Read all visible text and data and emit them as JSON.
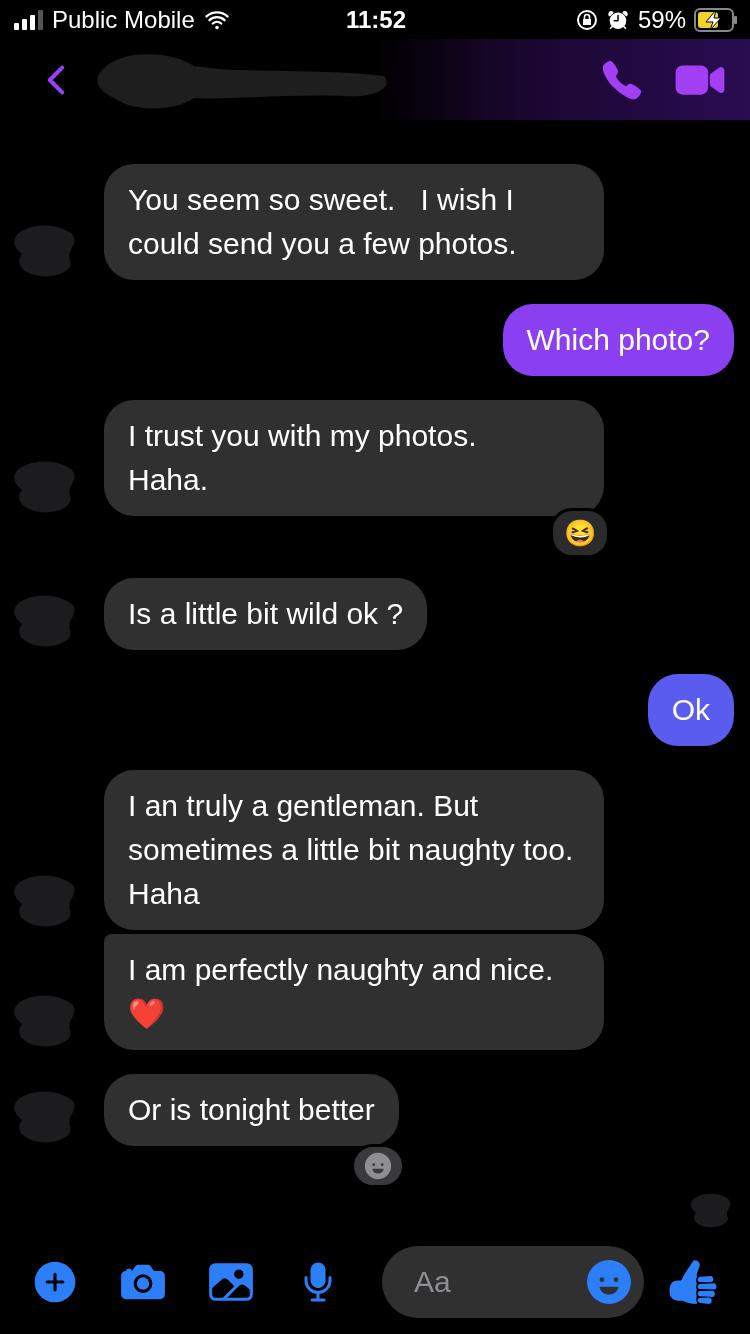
{
  "status_bar": {
    "carrier": "Public Mobile",
    "time": "11:52",
    "battery": "59%",
    "charging": true
  },
  "header": {
    "back": true
  },
  "messages": [
    {
      "kind": "incoming",
      "text": "You seem so sweet.   I wish I could send you a few photos.",
      "grouped": false
    },
    {
      "kind": "outgoing",
      "text": "Which photo?",
      "color": "#8a3ff0",
      "grouped": false
    },
    {
      "kind": "incoming",
      "text": "I trust you with my photos.   Haha.",
      "reaction": "😆",
      "grouped": false
    },
    {
      "kind": "incoming",
      "text": "Is a little bit wild ok ?",
      "grouped": false
    },
    {
      "kind": "outgoing",
      "text": "Ok",
      "color": "#5a5cf0",
      "grouped": false
    },
    {
      "kind": "incoming",
      "text": "I an truly a gentleman. But sometimes a little bit naughty too.   Haha",
      "grouped": false
    },
    {
      "kind": "incoming",
      "text": "I am perfectly naughty and nice. ❤️",
      "grouped": true
    },
    {
      "kind": "incoming",
      "text": "Or is tonight better",
      "react_button": true,
      "grouped": false
    }
  ],
  "composer": {
    "placeholder": "Aa"
  }
}
